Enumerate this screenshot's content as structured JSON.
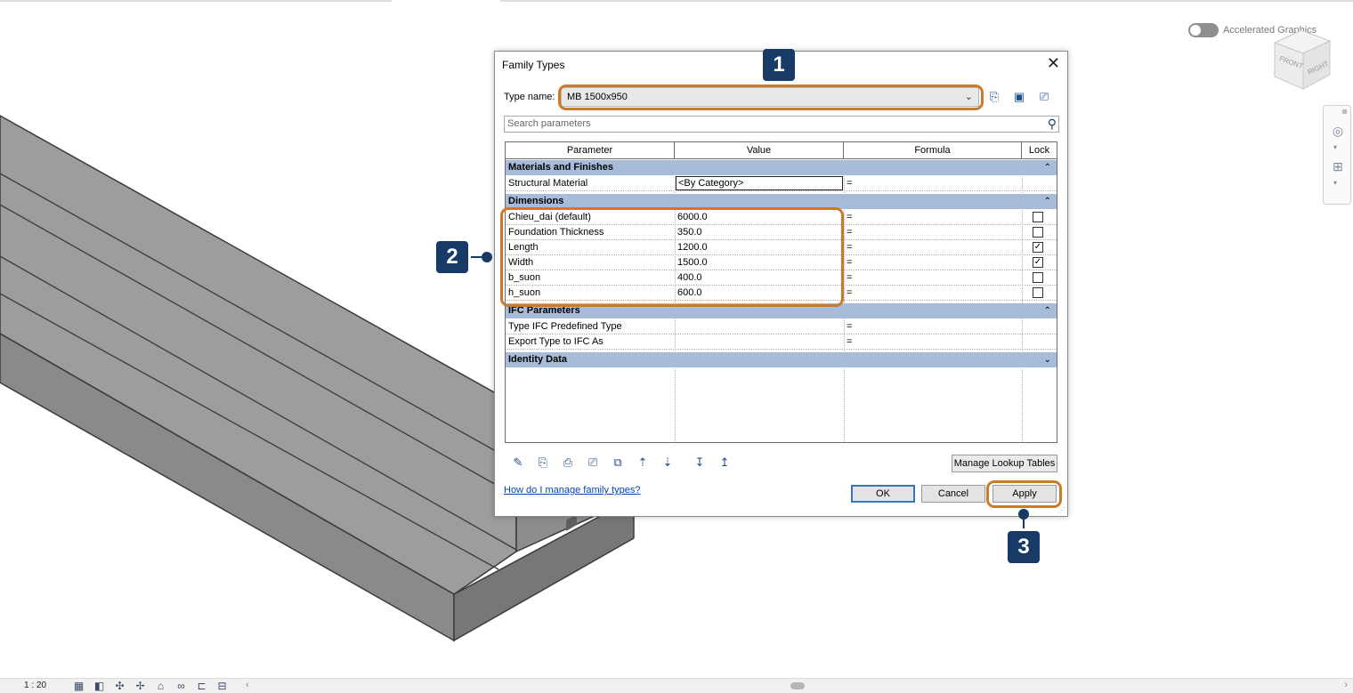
{
  "dialog": {
    "title": "Family Types",
    "type_name_label": "Type name:",
    "type_name_value": "MB 1500x950",
    "search_placeholder": "Search parameters",
    "columns": {
      "parameter": "Parameter",
      "value": "Value",
      "formula": "Formula",
      "lock": "Lock"
    },
    "groups": {
      "materials": {
        "label": "Materials and Finishes",
        "rows": [
          {
            "parameter": "Structural Material",
            "value": "<By Category>",
            "formula": "="
          }
        ]
      },
      "dimensions": {
        "label": "Dimensions",
        "rows": [
          {
            "parameter": "Chieu_dai (default)",
            "value": "6000.0",
            "formula": "=",
            "locked": false
          },
          {
            "parameter": "Foundation Thickness",
            "value": "350.0",
            "formula": "=",
            "locked": false
          },
          {
            "parameter": "Length",
            "value": "1200.0",
            "formula": "=",
            "locked": true
          },
          {
            "parameter": "Width",
            "value": "1500.0",
            "formula": "=",
            "locked": true
          },
          {
            "parameter": "b_suon",
            "value": "400.0",
            "formula": "=",
            "locked": false
          },
          {
            "parameter": "h_suon",
            "value": "600.0",
            "formula": "=",
            "locked": false
          }
        ]
      },
      "ifc": {
        "label": "IFC Parameters",
        "rows": [
          {
            "parameter": "Type IFC Predefined Type",
            "value": "",
            "formula": "="
          },
          {
            "parameter": "Export Type to IFC As",
            "value": "",
            "formula": "="
          }
        ]
      },
      "identity": {
        "label": "Identity Data"
      }
    },
    "manage_lookup_label": "Manage Lookup Tables",
    "help_link": "How do I manage family types?",
    "ok_label": "OK",
    "cancel_label": "Cancel",
    "apply_label": "Apply"
  },
  "viewport": {
    "accelerated_graphics_label": "Accelerated Graphics",
    "viewcube_front": "FRONT",
    "viewcube_right": "RIGHT"
  },
  "statusbar": {
    "scale": "1 : 20"
  },
  "annotations": {
    "step1": "1",
    "step2": "2",
    "step3": "3"
  },
  "colors": {
    "highlight": "#cc7a2a",
    "badge": "#173a66",
    "group_header": "#a6bcd9",
    "model_top": "#9e9e9e",
    "model_side": "#808080"
  }
}
